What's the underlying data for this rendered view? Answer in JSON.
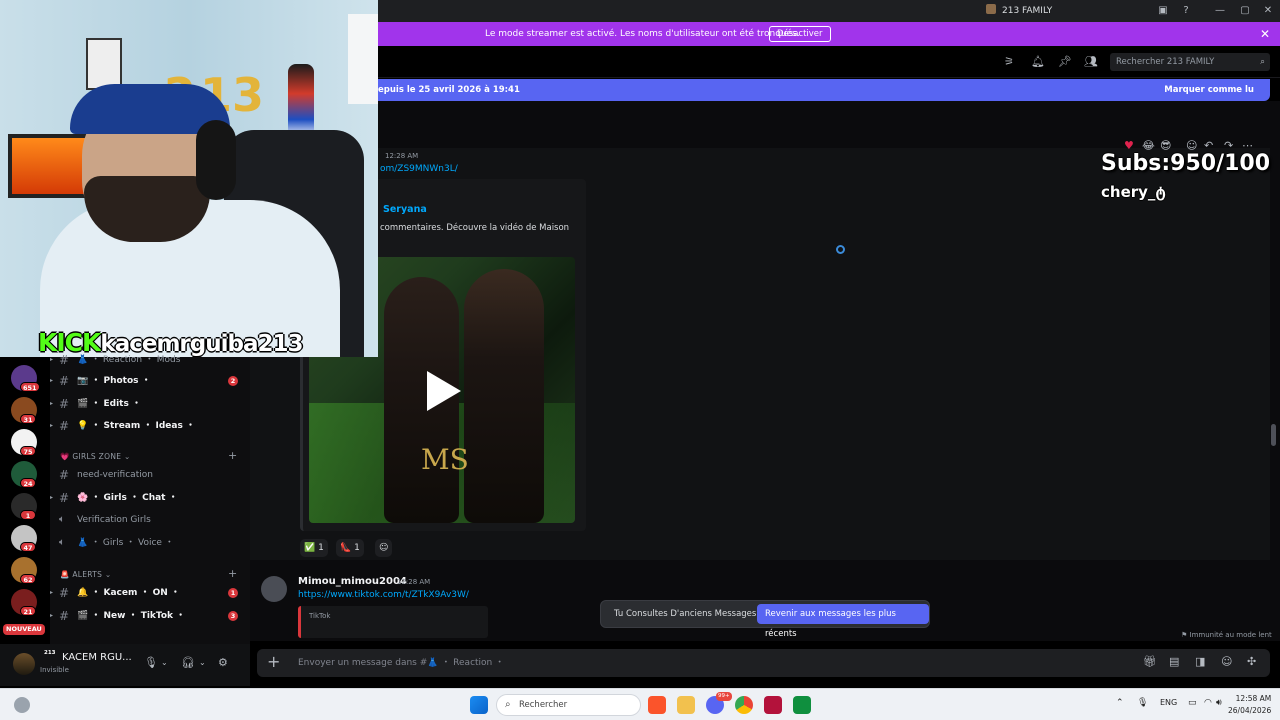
{
  "window": {
    "title": "213 FAMILY"
  },
  "streamer_banner": {
    "message": "Le mode streamer est activé. Les noms d'utilisateur ont été tronqués.",
    "button": "Désactiver"
  },
  "header": {
    "search_placeholder": "Rechercher 213 FAMILY"
  },
  "new_messages": {
    "since": "epuis le 25 avril 2026 à 19:41",
    "mark_read": "Marquer comme lu"
  },
  "message1": {
    "timestamp": "12:28 AM",
    "link": "om/ZS9MNWn3L/",
    "embed_author": "Seryana",
    "embed_desc": "commentaires. Découvre la vidéo de Maison",
    "video_watermark": "MS",
    "reactions": [
      {
        "emoji": "✅",
        "count": "1"
      },
      {
        "emoji": "👠",
        "count": "1"
      }
    ]
  },
  "message2": {
    "author": "Mimou_mimou2004",
    "timestamp": "12:28 AM",
    "link": "https://www.tiktok.com/t/ZTkX9Av3W/",
    "embed_provider": "TikTok"
  },
  "overlay": {
    "subs": "Subs:950/100",
    "user": "chery_ტ"
  },
  "stream_overlay": {
    "platform": "KICK",
    "username": "kacemrguiba213"
  },
  "jump": {
    "text": "Tu Consultes D'anciens Messages",
    "button": "Revenir aux messages les plus récents"
  },
  "slowmode": "Immunité au mode lent",
  "composer": {
    "placeholder": "Envoyer un message dans #👗 ・ Reaction ・"
  },
  "servers": [
    {
      "badge": "651",
      "color": "#5b3a8c"
    },
    {
      "badge": "31",
      "color": "#8a4a1f"
    },
    {
      "badge": "75",
      "color": "#f2f2f2"
    },
    {
      "badge": "24",
      "color": "#1f5b3a"
    },
    {
      "badge": "1",
      "color": "#2a2a2a"
    },
    {
      "badge": "47",
      "color": "#c4c4c4"
    },
    {
      "badge": "62",
      "color": "#a8712e"
    },
    {
      "badge": "21",
      "color": "#7a1e1e"
    }
  ],
  "nouveau": "NOUVEAU",
  "channels": {
    "top_partial": "👗 ・ Reaction ・ Mods",
    "items1": [
      {
        "label": "📷 ・ Photos ・",
        "count": "2"
      },
      {
        "label": "🎬 ・ Edits ・",
        "count": ""
      },
      {
        "label": "💡 ・ Stream ・ Ideas ・",
        "count": ""
      }
    ],
    "cat_girls": "💗 GIRLS ZONE ⌄",
    "girls": [
      {
        "label": "need-verification",
        "muted": true
      },
      {
        "label": "🌸 ・ Girls ・ Chat ・",
        "muted": false
      },
      {
        "label": "Verification Girls",
        "muted": true
      },
      {
        "label": "👗 ・ Girls ・ Voice ・",
        "muted": true
      }
    ],
    "cat_alerts": "🚨 ALERTS ⌄",
    "alerts": [
      {
        "label": "🔔 ・ Kacem ・ ON ・",
        "count": "1"
      },
      {
        "label": "🎬 ・ New ・ TikTok ・",
        "count": "3"
      }
    ]
  },
  "user": {
    "name": "KACEM RGU...",
    "status": "Invisible",
    "tag": "213"
  },
  "taskbar": {
    "search": "Rechercher",
    "lang": "ENG",
    "time": "12:58 AM",
    "date": "26/04/2026",
    "discord_badge": "99+"
  }
}
